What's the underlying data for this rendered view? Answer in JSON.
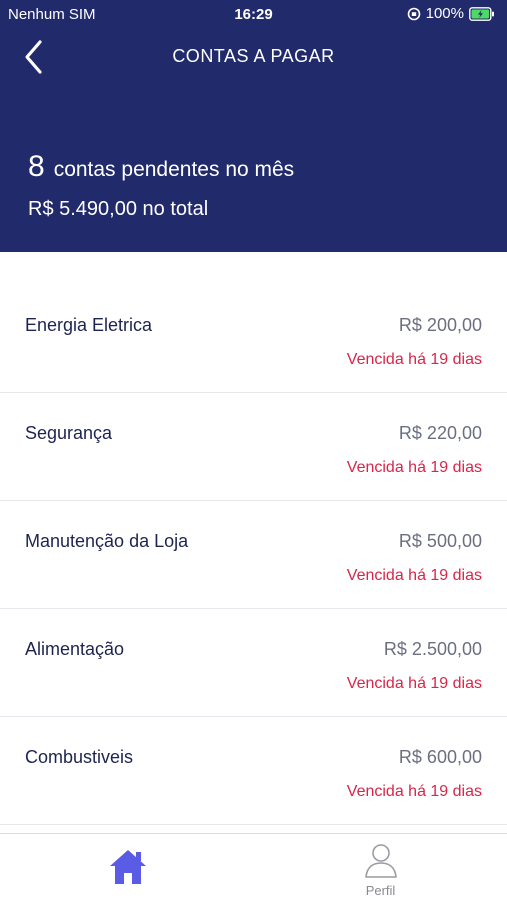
{
  "status_bar": {
    "carrier": "Nenhum SIM",
    "time": "16:29",
    "battery": "100%"
  },
  "nav": {
    "title": "CONTAS A PAGAR"
  },
  "summary": {
    "count": "8",
    "count_text": "contas pendentes no mês",
    "total": "R$ 5.490,00 no total"
  },
  "bills": [
    {
      "name": "Energia Eletrica",
      "amount": "R$ 200,00",
      "status": "Vencida há 19 dias"
    },
    {
      "name": "Segurança",
      "amount": "R$ 220,00",
      "status": "Vencida há 19 dias"
    },
    {
      "name": "Manutenção da Loja",
      "amount": "R$ 500,00",
      "status": "Vencida há 19 dias"
    },
    {
      "name": "Alimentação",
      "amount": "R$ 2.500,00",
      "status": "Vencida há 19 dias"
    },
    {
      "name": "Combustiveis",
      "amount": "R$ 600,00",
      "status": "Vencida há 19 dias"
    }
  ],
  "tabs": {
    "home": {
      "icon": "home-icon",
      "active": true
    },
    "profile": {
      "icon": "profile-icon",
      "label": "Perfil"
    }
  },
  "colors": {
    "header": "#212a6b",
    "overdue": "#d8264b",
    "active_tab": "#5b5ce6"
  }
}
